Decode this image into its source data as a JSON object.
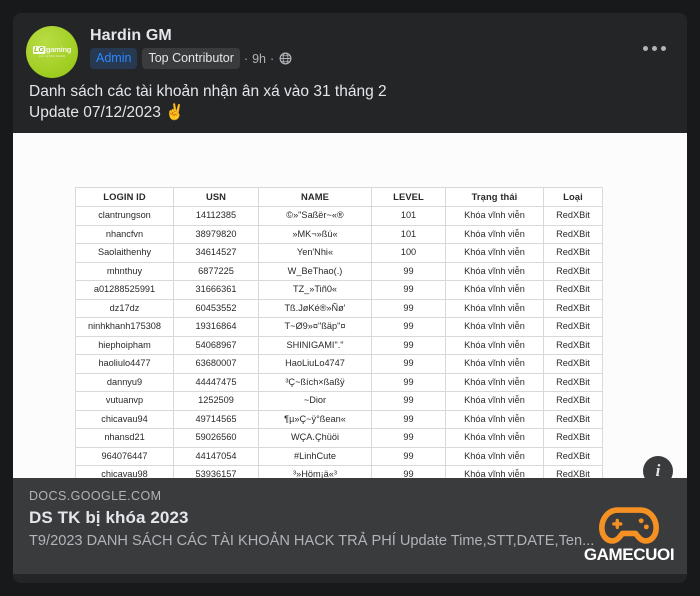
{
  "post": {
    "author": "Hardin GM",
    "avatar_icon": "lg-gaming-logo",
    "avatar_logo_text": "gaming",
    "avatar_logo_sub": "LG ULTRA GEAR",
    "badges": {
      "admin": "Admin",
      "top_contributor": "Top Contributor"
    },
    "separator": "·",
    "time": "9h",
    "audience_icon": "globe-icon",
    "more_icon": "more-options-icon",
    "body": "Danh sách các tài khoản nhận ân xá vào 31 tháng 2\nUpdate 07/12/2023 ✌️"
  },
  "table": {
    "headers": [
      "LOGIN ID",
      "USN",
      "NAME",
      "LEVEL",
      "Trạng thái",
      "Loại"
    ],
    "rows": [
      [
        "clantrungson",
        "14112385",
        "©»\"Saßër~«®",
        "101",
        "Khóa vĩnh viễn",
        "RedXBit"
      ],
      [
        "nhancfvn",
        "38979820",
        "»MK¬»ßú«",
        "101",
        "Khóa vĩnh viễn",
        "RedXBit"
      ],
      [
        "Saolaithenhy",
        "34614527",
        "Yen'Nhi«",
        "100",
        "Khóa vĩnh viễn",
        "RedXBit"
      ],
      [
        "mhnthuy",
        "6877225",
        "W_BeThao(.)",
        "99",
        "Khóa vĩnh viễn",
        "RedXBit"
      ],
      [
        "a01288525991",
        "31666361",
        "TZ_»Tiñ0«",
        "99",
        "Khóa vĩnh viễn",
        "RedXBit"
      ],
      [
        "dz17dz",
        "60453552",
        "Tß.JøKé®»Ñø'",
        "99",
        "Khóa vĩnh viễn",
        "RedXBit"
      ],
      [
        "ninhkhanh175308",
        "19316864",
        "T~Ø9»¤\"ßäp\"¤",
        "99",
        "Khóa vĩnh viễn",
        "RedXBit"
      ],
      [
        "hiephoipham",
        "54068967",
        "SHINIGAMI\".\"",
        "99",
        "Khóa vĩnh viễn",
        "RedXBit"
      ],
      [
        "haoliulo4477",
        "63680007",
        "HaoLiuLo4747",
        "99",
        "Khóa vĩnh viễn",
        "RedXBit"
      ],
      [
        "dannyu9",
        "44447475",
        "³Ç~ßích×ßaßÿ",
        "99",
        "Khóa vĩnh viễn",
        "RedXBit"
      ],
      [
        "vutuanvp",
        "1252509",
        "~Dior",
        "99",
        "Khóa vĩnh viễn",
        "RedXBit"
      ],
      [
        "chicavau94",
        "49714565",
        "¶µ»Ç~ÿ°ßean«",
        "99",
        "Khóa vĩnh viễn",
        "RedXBit"
      ],
      [
        "nhansd21",
        "59026560",
        "WÇA.Çhüöi",
        "99",
        "Khóa vĩnh viễn",
        "RedXBit"
      ],
      [
        "964076447",
        "44147054",
        "#LinhCute",
        "99",
        "Khóa vĩnh viễn",
        "RedXBit"
      ],
      [
        "chicavau98",
        "53936157",
        "³»Höm¡ä«³",
        "99",
        "Khóa vĩnh viễn",
        "RedXBit"
      ]
    ]
  },
  "link_preview": {
    "domain": "DOCS.GOOGLE.COM",
    "title": "DS TK bị khóa 2023",
    "description": "T9/2023 DANH SÁCH CÁC TÀI KHOẢN HACK TRẢ PHÍ Update Time,STT,DATE,Ten..."
  },
  "info_button": {
    "icon": "info-icon",
    "label": "i"
  },
  "watermark": {
    "icon": "gamepad-icon",
    "text": "GAMECUOI",
    "color": "#F59023"
  },
  "colors": {
    "page_bg": "#18191a",
    "card_bg": "#242526",
    "overlay_bg": "#3a3b3c",
    "text_primary": "#e4e6eb",
    "text_secondary": "#b0b3b8",
    "admin_badge_text": "#2d88ff",
    "avatar_green": "#a8d22c"
  }
}
